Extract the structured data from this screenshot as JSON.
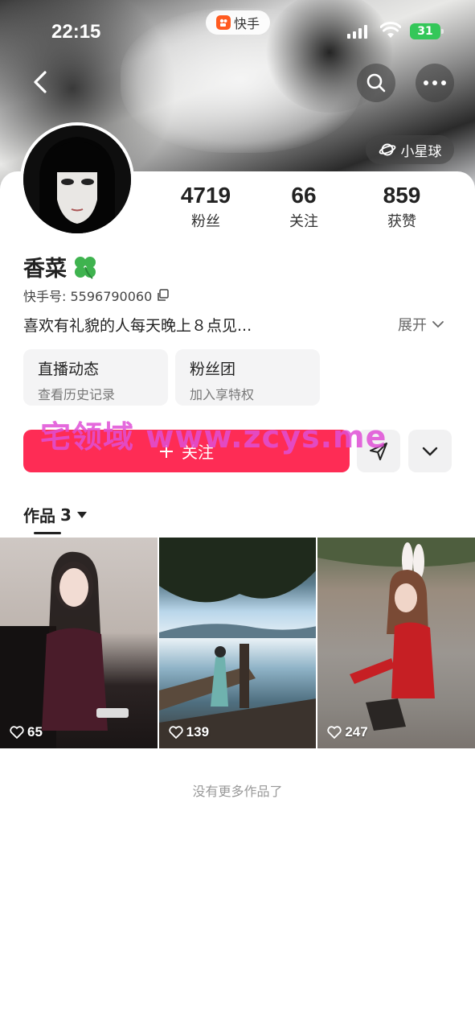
{
  "status_bar": {
    "time": "22:15",
    "app_name": "快手",
    "battery": "31"
  },
  "header": {
    "planet_label": "小星球"
  },
  "profile": {
    "name": "香菜",
    "uid_label": "快手号: 5596790060",
    "bio": "喜欢有礼貌的人每天晚上８点见...",
    "expand_label": "展开"
  },
  "stats": [
    {
      "value": "4719",
      "label": "粉丝"
    },
    {
      "value": "66",
      "label": "关注"
    },
    {
      "value": "859",
      "label": "获赞"
    }
  ],
  "features": [
    {
      "title": "直播动态",
      "subtitle": "查看历史记录"
    },
    {
      "title": "粉丝团",
      "subtitle": "加入享特权"
    }
  ],
  "actions": {
    "follow_label": "关注"
  },
  "watermark": "宅领域 www.zcys.me",
  "works": {
    "tab_label": "作品",
    "count": "3",
    "items": [
      {
        "likes": "65"
      },
      {
        "likes": "139"
      },
      {
        "likes": "247"
      }
    ],
    "end_text": "没有更多作品了"
  },
  "colors": {
    "accent": "#fe2c55",
    "brand": "#ff5a1f",
    "battery": "#34c759"
  }
}
